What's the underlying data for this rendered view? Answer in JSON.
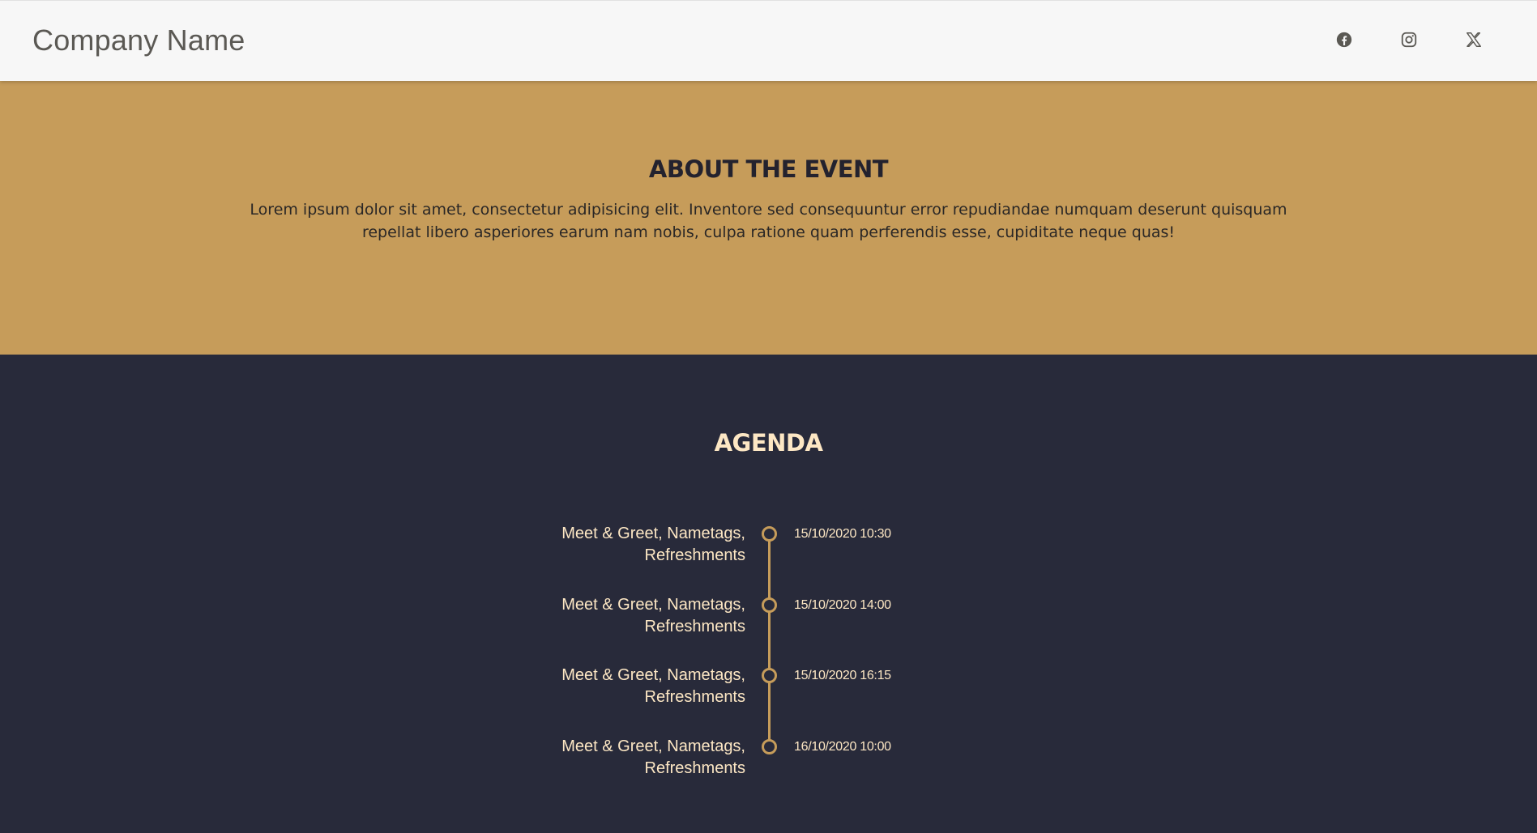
{
  "header": {
    "brand": "Company Name",
    "social": [
      {
        "icon": "facebook-icon"
      },
      {
        "icon": "instagram-icon"
      },
      {
        "icon": "x-icon"
      }
    ]
  },
  "about": {
    "title": "ABOUT THE EVENT",
    "text": "Lorem ipsum dolor sit amet, consectetur adipisicing elit. Inventore sed consequuntur error repudiandae numquam deserunt quisquam repellat libero asperiores earum nam nobis, culpa ratione quam perferendis esse, cupiditate neque quas!"
  },
  "agenda": {
    "title": "AGENDA",
    "items": [
      {
        "label": "Meet & Greet, Nametags, Refreshments",
        "time": "15/10/2020 10:30"
      },
      {
        "label": "Meet & Greet, Nametags, Refreshments",
        "time": "15/10/2020 14:00"
      },
      {
        "label": "Meet & Greet, Nametags, Refreshments",
        "time": "15/10/2020 16:15"
      },
      {
        "label": "Meet & Greet, Nametags, Refreshments",
        "time": "16/10/2020 10:00"
      }
    ]
  },
  "colors": {
    "header_bg": "#f7f7f7",
    "accent_gold": "#c69c5a",
    "dark_bg": "#282a3a",
    "cream_text": "#fde7c4"
  }
}
